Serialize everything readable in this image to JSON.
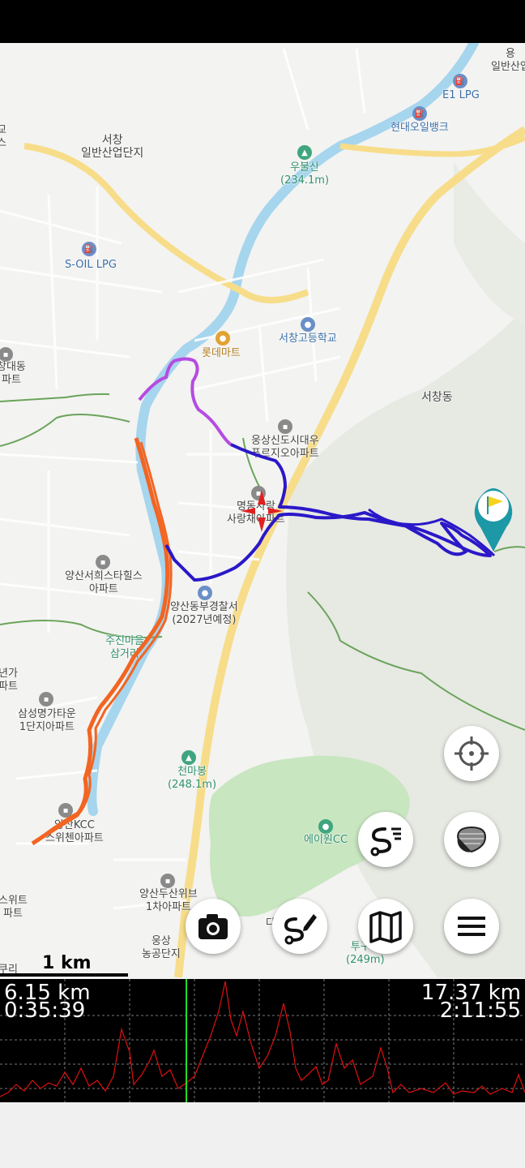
{
  "map": {
    "labels": {
      "industrial": "서창\n일반산업단지",
      "ubulsan": "우불산\n(234.1m)",
      "e1lpg": "E1 LPG",
      "hyundai_oilbank": "현대오일뱅크",
      "ilbansan": "용\n일반산업",
      "soil_lpg": "S-OIL LPG",
      "lotte_mart": "롯데마트",
      "seochang_high": "서창고등학교",
      "seochang_dong": "서창동",
      "changdaedong": "창대동\n파트",
      "ungsang_apt": "웅상신도시대우\n푸르지오아파트",
      "sarang_apt": "명동사랑\n사랑채아파트",
      "hills_apt": "양산서희스타힐스\n아파트",
      "police": "양산동부경찰서\n(2027년예정)",
      "jujin": "주진마을\n삼거리",
      "nyeonga": "년가\n파트",
      "samsung_apt": "삼성명가타운\n1단지아파트",
      "cheonmabong": "천마봉\n(248.1m)",
      "aone_cc": "에이원CC",
      "yangsan_apt": "양산KCC\n스위첸아파트",
      "duksan_apt": "양산두산위브\n1차아파트",
      "swit_apt": "스위트\n파트",
      "ungsang_farm": "웅상\n농공단지",
      "tugu": "투구봉\n(249m)",
      "gyo": "교\n스",
      "kuri": "쿠리",
      "da": "다"
    },
    "scale_label": "1 km"
  },
  "buttons": {
    "locate": "my-location",
    "layers": "map-layers",
    "route": "route-list",
    "camera": "camera",
    "draw": "draw-route",
    "map_type": "map-type",
    "menu": "menu"
  },
  "profile": {
    "cursor_distance": "6.15 km",
    "cursor_time": "0:35:39",
    "total_distance": "17.37 km",
    "total_time": "2:11:55"
  },
  "colors": {
    "track_orange": "#f26522",
    "track_purple": "#b64be0",
    "track_blue": "#2a18c8",
    "river": "#a6d5ee",
    "road_yellow": "#f7dd8a",
    "park": "#c8e6c0",
    "elevation_line": "#e01010",
    "cursor_line": "#22dd22"
  }
}
